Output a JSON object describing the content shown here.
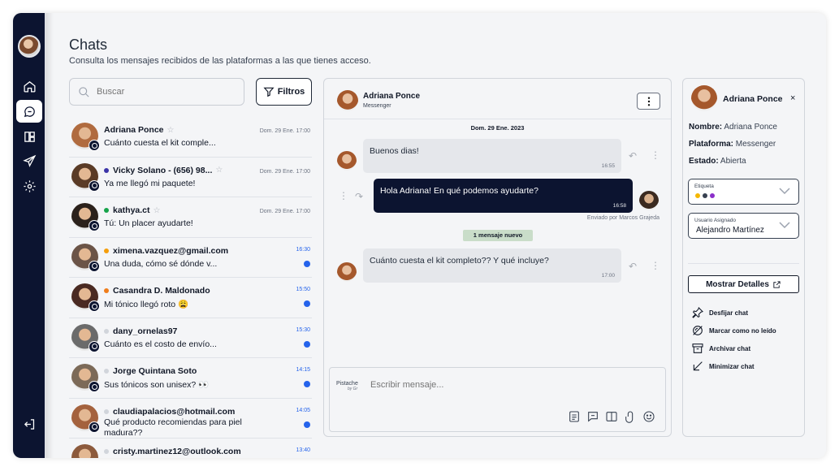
{
  "header": {
    "title": "Chats",
    "subtitle": "Consulta los mensajes recibidos de las plataformas a las que tienes acceso."
  },
  "search": {
    "placeholder": "Buscar"
  },
  "filters": {
    "label": "Filtros"
  },
  "chats": [
    {
      "name": "Adriana Ponce",
      "message": "Cuánto cuesta el kit comple...",
      "time": "Dom. 29 Ene. 17:00",
      "dot": "",
      "unread": false,
      "pinned": true,
      "avatar": "#b06b3f"
    },
    {
      "name": "Vicky Solano - (656) 98...",
      "message": "Ya me llegó mi paquete!",
      "time": "Dom. 29 Ene. 17:00",
      "dot": "#3b34a8",
      "unread": false,
      "pinned": true,
      "avatar": "#5a3b26"
    },
    {
      "name": "kathya.ct",
      "message": "Tú: Un placer ayudarte!",
      "time": "Dom. 29 Ene. 17:00",
      "dot": "#16a34a",
      "unread": false,
      "pinned": true,
      "avatar": "#2b211b"
    },
    {
      "name": "ximena.vazquez@gmail.com",
      "message": "Una duda, cómo sé dónde v...",
      "time": "16:30",
      "dot": "#f59e0b",
      "unread": true,
      "pinned": false,
      "avatar": "#6b5447"
    },
    {
      "name": "Casandra D. Maldonado",
      "message": "Mi tónico llegó roto 😩",
      "time": "15:50",
      "dot": "#ef7d1a",
      "unread": true,
      "pinned": false,
      "avatar": "#4a2a22"
    },
    {
      "name": "dany_ornelas97",
      "message": "Cuánto es el costo de envío...",
      "time": "15:30",
      "dot": "#d1d5db",
      "unread": true,
      "pinned": false,
      "avatar": "#6b6b6b"
    },
    {
      "name": "Jorge Quintana Soto",
      "message": "Sus tónicos son unisex? 👀",
      "time": "14:15",
      "dot": "#d1d5db",
      "unread": true,
      "pinned": false,
      "avatar": "#7c6a58"
    },
    {
      "name": "claudiapalacios@hotmail.com",
      "message": "Qué producto recomiendas para piel madura??",
      "time": "14:05",
      "dot": "#d1d5db",
      "unread": true,
      "pinned": false,
      "avatar": "#a4623e"
    },
    {
      "name": "cristy.martinez12@outlook.com",
      "message": "",
      "time": "13:40",
      "dot": "#d1d5db",
      "unread": false,
      "pinned": false,
      "avatar": "#8c5a3c"
    }
  ],
  "conversation": {
    "name": "Adriana Ponce",
    "platform": "Messenger",
    "date": "Dom. 29 Ene. 2023",
    "messages": [
      {
        "text": "Buenos dias!",
        "time": "16:55"
      },
      {
        "text": "Hola Adriana! En qué podemos ayudarte?",
        "time": "16:58"
      },
      {
        "text": "Cuánto cuesta el kit completo?? Y qué incluye?",
        "time": "17:00"
      }
    ],
    "sent_by": "Enviado por Marcos Grajeda",
    "new_badge": "1 mensaje nuevo",
    "composer": {
      "logo": "Pistache",
      "logo_sub": "by Gr",
      "placeholder": "Escribir mensaje..."
    }
  },
  "details": {
    "name": "Adriana Ponce",
    "close": "×",
    "fields": {
      "name_label": "Nombre:",
      "name_value": "Adriana Ponce",
      "platform_label": "Plataforma:",
      "platform_value": "Messenger",
      "status_label": "Estado:",
      "status_value": "Abierta"
    },
    "tag": {
      "label": "Etiqueta",
      "colors": [
        "#f5b700",
        "#374151",
        "#8b2fc9"
      ]
    },
    "assigned": {
      "label": "Usuario Asignado",
      "value": "Alejandro Martínez"
    },
    "show_details": "Mostrar Detalles",
    "actions": [
      "Desfijar chat",
      "Marcar como no leído",
      "Archivar chat",
      "Minimizar chat"
    ]
  },
  "icons": {
    "rail": [
      "home-icon",
      "chats-icon",
      "dashboard-icon",
      "send-icon",
      "settings-icon",
      "logout-icon"
    ],
    "accent": "#0c1430",
    "unread": "#2563eb"
  }
}
